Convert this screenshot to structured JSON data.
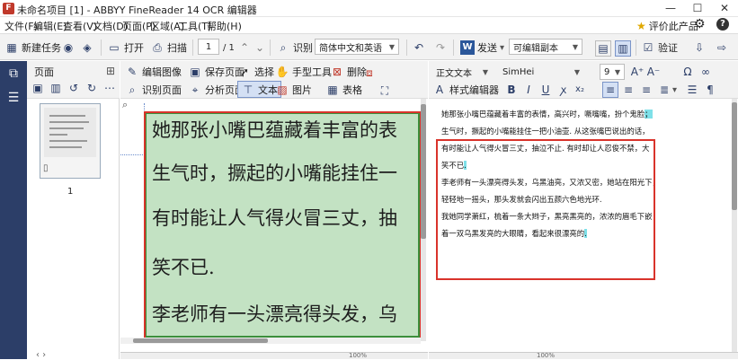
{
  "window": {
    "title": "未命名项目 [1] - ABBYY FineReader 14 OCR 编辑器",
    "minimize": "—",
    "maximize": "☐",
    "close": "✕"
  },
  "menu": [
    "文件(F)",
    "编辑(E)",
    "查看(V)",
    "文档(D)",
    "页面(P)",
    "区域(A)",
    "工具(T)",
    "帮助(H)"
  ],
  "menu_right": {
    "rate_label": "评价此产品"
  },
  "toolbar": {
    "new_task": "新建任务",
    "open": "打开",
    "scan": "扫描",
    "page_value": "1",
    "page_total": "/ 1",
    "recognize": "识别",
    "language": "简体中文和英语",
    "send": "发送",
    "send_target": "可编辑副本",
    "verify": "验证"
  },
  "pages_panel": {
    "title": "页面",
    "thumb_number": "1"
  },
  "image_panel": {
    "edit_image": "编辑图像",
    "save_page": "保存页面",
    "select": "选择",
    "hand_tool": "手型工具",
    "recognize_page": "识别页面",
    "analyze_page": "分析页面",
    "text_area": "文本",
    "picture_area": "图片",
    "delete": "删除",
    "table_area": "表格",
    "image_lines": [
      "她那张小嘴巴蕴藏着丰富的表",
      "生气时，撅起的小嘴能挂住一",
      "有时能让人气得火冒三丈，抽",
      "笑不已.",
      "李老师有一头漂亮得头发，乌"
    ],
    "zoom": "100%"
  },
  "text_panel": {
    "style": "正文文本",
    "font": "SimHei",
    "size": "9",
    "style_editor": "样式编辑器",
    "bold": "B",
    "italic": "I",
    "underline": "U",
    "lines": [
      {
        "text": "她那张小嘴巴蕴藏着丰富的表情，高兴时，噘嘴嘴，扮个鬼脸",
        "hl": "；"
      },
      {
        "text": "生气时，撅起的小嘴能挂住一把小油壶. 从这张嘴巴说出的话，",
        "hl": ""
      },
      {
        "text": "有时能让人气得火冒三丈，抽泣不止. 有时却让人忍俊不禁，大",
        "hl": ""
      },
      {
        "text": "笑不已",
        "hl": "."
      },
      {
        "text": "李老师有一头漂亮得头发，乌黑油亮，又浓又密，她站在阳光下，",
        "hl": ""
      },
      {
        "text": "轻轻地一摇头，那头发就会闪出五颜六色地光环.",
        "hl": ""
      },
      {
        "text": "我她同学萧红，梳着一条大辫子，黑亮黑亮的，浓浓的眉毛下嵌",
        "hl": ""
      },
      {
        "text": "着一双乌黑发亮的大眼睛，看起来很漂亮的",
        "hl": "."
      }
    ],
    "zoom": "100%"
  },
  "colors": {
    "accent": "#2c3e68",
    "zone_fill": "#c3e2c3",
    "zone_border": "#3c8f3c",
    "highlight": "#d9332b",
    "uncertain": "#7ee0e8"
  }
}
